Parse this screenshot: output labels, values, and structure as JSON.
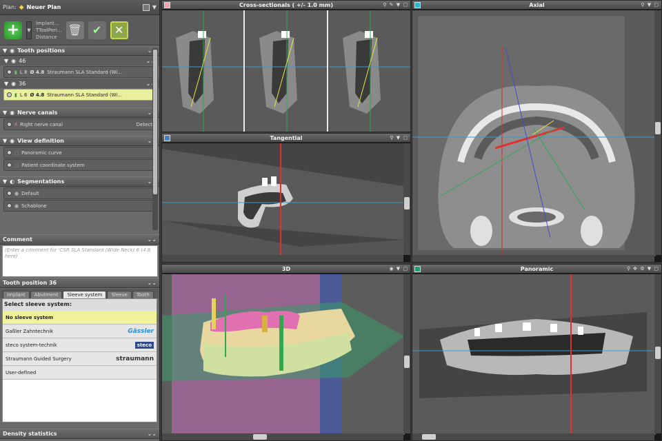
{
  "plan": {
    "label": "Plan:",
    "name": "Neuer Plan",
    "dropdown": "▼"
  },
  "toolbar": {
    "menu_items": [
      "Implant...",
      "TToolPeri...",
      "Distance"
    ]
  },
  "tooth_positions": {
    "title": "Tooth positions",
    "groups": [
      {
        "label": "46",
        "row": {
          "length": "L 8",
          "diameter": "Ø 4.8",
          "name": "Straumann SLA Standard (Wi..."
        }
      },
      {
        "label": "36",
        "row": {
          "length": "L 6",
          "diameter": "Ø 4.8",
          "name": "Straumann SLA Standard (Wi..."
        }
      }
    ]
  },
  "nerve_canals": {
    "title": "Nerve canals",
    "item": "Right nerve canal",
    "detect_label": "Detect"
  },
  "view_definition": {
    "title": "View definition",
    "items": [
      "Panoramic curve",
      "Patient coordinate system"
    ]
  },
  "segmentations": {
    "title": "Segmentations",
    "items": [
      "Default",
      "Schablone"
    ]
  },
  "comment": {
    "title": "Comment",
    "placeholder": "(Enter a comment for 'CSR SLA Standard (Wide Neck) 6 (4.8 here)"
  },
  "tooth_position_panel": {
    "title": "Tooth position 36",
    "tabs": [
      "Implant",
      "Abutment",
      "Sleeve system",
      "Tooth"
    ],
    "active_tab": "Sleeve system",
    "select_label": "Select sleeve system:",
    "options": [
      {
        "label": "No sleeve system",
        "logo": ""
      },
      {
        "label": "Gaßler Zahntechnik",
        "logo": "Gässler"
      },
      {
        "label": "steco system-technik",
        "logo": "steco"
      },
      {
        "label": "Straumann Guided Surgery",
        "logo": "straumann"
      },
      {
        "label": "User-defined",
        "logo": ""
      }
    ]
  },
  "density": {
    "title": "Density statistics"
  },
  "views": {
    "cross": {
      "title": "Cross-sectionals ( +/- 1.0 mm)",
      "color": "#f0a0b0"
    },
    "tangential": {
      "title": "Tangential",
      "color": "#3a7fd0"
    },
    "axial": {
      "title": "Axial",
      "color": "#38b4c8"
    },
    "three_d": {
      "title": "3D"
    },
    "panoramic": {
      "title": "Panoramic",
      "color": "#1f9a6a"
    }
  },
  "colors": {
    "selection": "#e9ef9f",
    "accent_green": "#8aa84a"
  }
}
